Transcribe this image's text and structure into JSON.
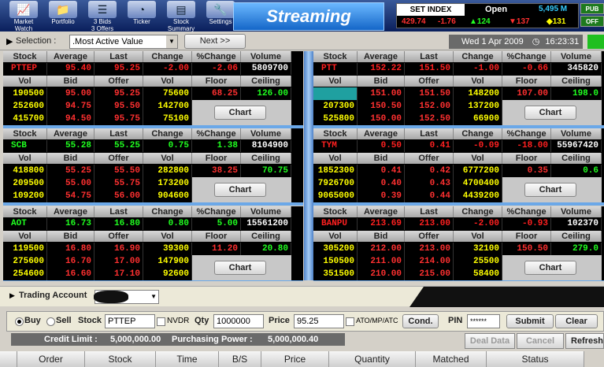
{
  "toolbar": [
    {
      "name": "market-watch",
      "label1": "Market",
      "label2": "Watch",
      "icon": "chart-icon",
      "glyph": "📈"
    },
    {
      "name": "portfolio",
      "label1": "Portfolio",
      "label2": "",
      "icon": "folder-icon",
      "glyph": "📁"
    },
    {
      "name": "3-bids-3-offers",
      "label1": "3 Bids",
      "label2": "3 Offers",
      "icon": "bids-icon",
      "glyph": "☰"
    },
    {
      "name": "ticker",
      "label1": "Ticker",
      "label2": "",
      "icon": "gauge-icon",
      "glyph": "◔"
    },
    {
      "name": "stock-summary",
      "label1": "Stock",
      "label2": "Summary",
      "icon": "summary-icon",
      "glyph": "▤"
    },
    {
      "name": "settings",
      "label1": "Settings",
      "label2": "",
      "icon": "wrench-icon",
      "glyph": "🔧"
    }
  ],
  "banner": "Streaming",
  "index": {
    "label": "SET INDEX",
    "value": "429.74",
    "change": "-1.76",
    "status": "Open",
    "volume": "5,495 M",
    "up": "▲124",
    "down": "▼137",
    "unchanged": "◆131"
  },
  "controls": [
    "PUB",
    "OFF"
  ],
  "selection": {
    "label": "Selection :",
    "value": ".Most Active Value",
    "next": "Next >>"
  },
  "datetime": {
    "date": "Wed 1 Apr 2009",
    "time": "16:23:31"
  },
  "headers1": [
    "Stock",
    "Average",
    "Last",
    "Change",
    "%Change",
    "Volume"
  ],
  "headers2": [
    "Vol",
    "Bid",
    "Offer",
    "Vol",
    "Floor",
    "Ceiling"
  ],
  "chart_label": "Chart",
  "stocks": [
    {
      "symbol": "PTTEP",
      "avg": "95.40",
      "last": "95.25",
      "chg": "-2.00",
      "pct": "-2.06",
      "vol": "5809700",
      "floor": "68.25",
      "ceil": "126.00",
      "color": "#ff2020",
      "rows": [
        [
          "190500",
          "95.00",
          "95.25",
          "75600"
        ],
        [
          "252600",
          "94.75",
          "95.50",
          "142700"
        ],
        [
          "415700",
          "94.50",
          "95.75",
          "75100"
        ]
      ]
    },
    {
      "symbol": "PTT",
      "avg": "152.22",
      "last": "151.50",
      "chg": "-1.00",
      "pct": "-0.66",
      "vol": "345820",
      "floor": "107.00",
      "ceil": "198.0",
      "color": "#ff2020",
      "rows": [
        [
          "",
          "151.00",
          "151.50",
          "148200"
        ],
        [
          "207300",
          "150.50",
          "152.00",
          "137200"
        ],
        [
          "525800",
          "150.00",
          "152.50",
          "66900"
        ]
      ]
    },
    {
      "symbol": "SCB",
      "avg": "55.28",
      "last": "55.25",
      "chg": "0.75",
      "pct": "1.38",
      "vol": "8104900",
      "floor": "38.25",
      "ceil": "70.75",
      "color": "#20ff20",
      "rows": [
        [
          "418800",
          "55.25",
          "55.50",
          "282800"
        ],
        [
          "209500",
          "55.00",
          "55.75",
          "173200"
        ],
        [
          "109200",
          "54.75",
          "56.00",
          "904600"
        ]
      ]
    },
    {
      "symbol": "TYM",
      "avg": "0.50",
      "last": "0.41",
      "chg": "-0.09",
      "pct": "-18.00",
      "vol": "55967420",
      "floor": "0.35",
      "ceil": "0.6",
      "color": "#ff2020",
      "rows": [
        [
          "1852300",
          "0.41",
          "0.42",
          "6777200"
        ],
        [
          "7926700",
          "0.40",
          "0.43",
          "4700400"
        ],
        [
          "9065000",
          "0.39",
          "0.44",
          "4439200"
        ]
      ]
    },
    {
      "symbol": "AOT",
      "avg": "16.73",
      "last": "16.80",
      "chg": "0.80",
      "pct": "5.00",
      "vol": "15561200",
      "floor": "11.20",
      "ceil": "20.80",
      "color": "#20ff20",
      "rows": [
        [
          "119500",
          "16.80",
          "16.90",
          "39300"
        ],
        [
          "275600",
          "16.70",
          "17.00",
          "147900"
        ],
        [
          "254600",
          "16.60",
          "17.10",
          "92600"
        ]
      ]
    },
    {
      "symbol": "BANPU",
      "avg": "213.69",
      "last": "213.00",
      "chg": "-2.00",
      "pct": "-0.93",
      "vol": "102370",
      "floor": "150.50",
      "ceil": "279.0",
      "color": "#ff2020",
      "rows": [
        [
          "305200",
          "212.00",
          "213.00",
          "32100"
        ],
        [
          "150500",
          "211.00",
          "214.00",
          "25500"
        ],
        [
          "351500",
          "210.00",
          "215.00",
          "58400"
        ]
      ]
    }
  ],
  "order": {
    "account_label": "Trading Account",
    "buy": "Buy",
    "sell": "Sell",
    "stock_label": "Stock",
    "stock": "PTTEP",
    "nvdr": "NVDR",
    "qty_label": "Qty",
    "qty": "1000000",
    "price_label": "Price",
    "price": "95.25",
    "atomp": "ATO/MP/ATC",
    "cond": "Cond.",
    "pin_label": "PIN",
    "pin": "******",
    "submit": "Submit",
    "clear": "Clear",
    "credit_label": "Credit Limit :",
    "credit": "5,000,000.00",
    "power_label": "Purchasing Power :",
    "power": "5,000,000.40",
    "deal": "Deal Data",
    "cancel": "Cancel",
    "refresh": "Refresh"
  },
  "order_columns": [
    "Order",
    "Stock",
    "Time",
    "B/S",
    "Price",
    "Quantity",
    "Matched",
    "Status"
  ]
}
